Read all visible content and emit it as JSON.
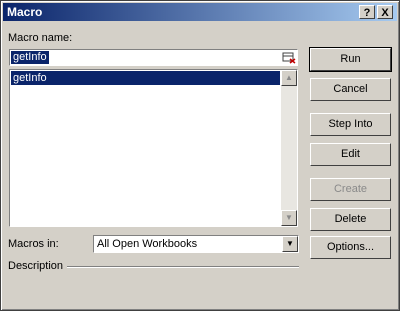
{
  "window": {
    "title": "Macro",
    "help_glyph": "?",
    "close_glyph": "X"
  },
  "macro_name": {
    "label": "Macro name:",
    "value": "getInfo"
  },
  "macro_list": {
    "items": [
      "getInfo"
    ],
    "selected": "getInfo"
  },
  "macros_in": {
    "label": "Macros in:",
    "value": "All Open Workbooks"
  },
  "description": {
    "label": "Description"
  },
  "buttons": {
    "run": "Run",
    "cancel": "Cancel",
    "step_into": "Step Into",
    "edit": "Edit",
    "create": "Create",
    "delete": "Delete",
    "options": "Options..."
  },
  "icons": {
    "help": "help-icon",
    "close": "close-icon",
    "name_picker": "refedit-icon",
    "scroll_up": "scroll-up-arrow-icon",
    "scroll_down": "scroll-down-arrow-icon",
    "dropdown": "dropdown-arrow-icon"
  },
  "colors": {
    "titlebar_start": "#0a246a",
    "titlebar_end": "#a6caf0",
    "selection": "#0a246a",
    "face": "#d4d0c8"
  }
}
